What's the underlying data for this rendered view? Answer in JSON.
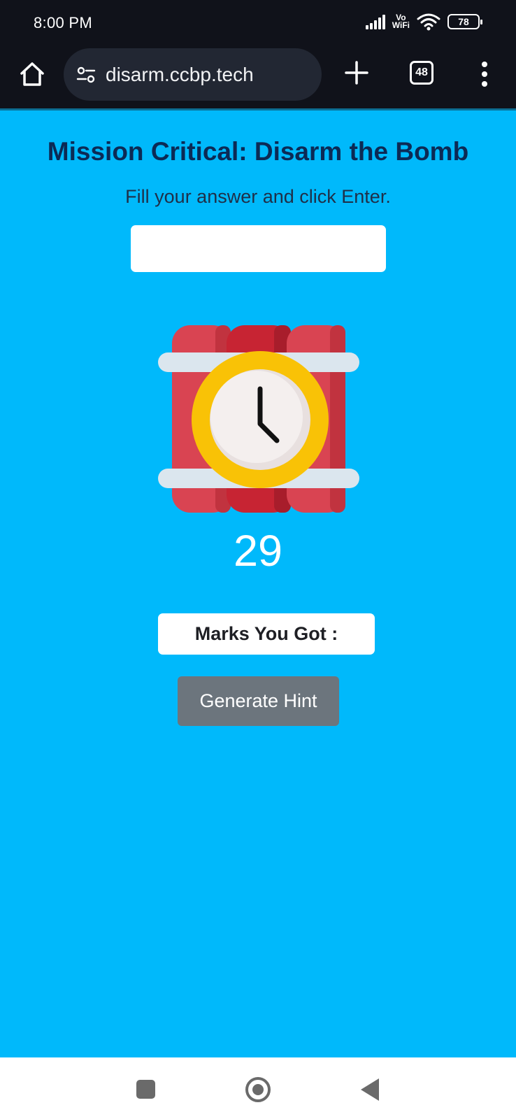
{
  "status_bar": {
    "time": "8:00 PM",
    "network_label_top": "Vo",
    "network_label_bottom": "WiFi",
    "battery": "78"
  },
  "browser": {
    "url": "disarm.ccbp.tech",
    "tab_count": "48",
    "icons": {
      "home": "home-icon",
      "site_settings": "tune-icon",
      "new_tab": "plus-icon",
      "menu": "more-vert-icon"
    }
  },
  "page": {
    "title": "Mission Critical: Disarm the Bomb",
    "instruction": "Fill your answer and click Enter.",
    "answer_input": {
      "value": "",
      "placeholder": ""
    },
    "timer": "29",
    "marks_label": "Marks You Got :",
    "hint_button": "Generate Hint",
    "image": "time-bomb-icon"
  },
  "colors": {
    "background": "#00b9fb",
    "title": "#0c2a55",
    "hint_button": "#6c757d",
    "bomb_red": "#d94452",
    "clock_ring": "#f9c206"
  }
}
